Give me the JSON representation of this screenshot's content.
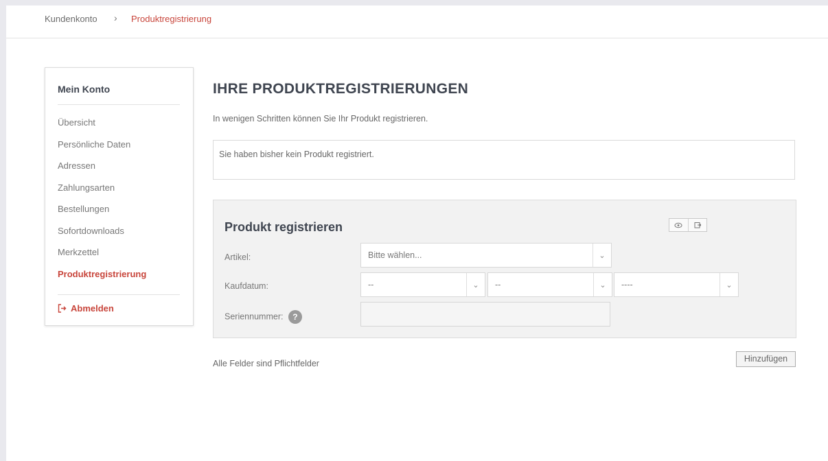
{
  "breadcrumb": {
    "home": "Kundenkonto",
    "separator": "›",
    "current": "Produktregistrierung"
  },
  "sidebar": {
    "title": "Mein Konto",
    "items": [
      {
        "label": "Übersicht"
      },
      {
        "label": "Persönliche Daten"
      },
      {
        "label": "Adressen"
      },
      {
        "label": "Zahlungsarten"
      },
      {
        "label": "Bestellungen"
      },
      {
        "label": "Sofortdownloads"
      },
      {
        "label": "Merkzettel"
      },
      {
        "label": "Produktregistrierung"
      }
    ],
    "logout_label": "Abmelden"
  },
  "main": {
    "title": "IHRE PRODUKTREGISTRIERUNGEN",
    "intro": "In wenigen Schritten können Sie Ihr Produkt registrieren.",
    "notice": "Sie haben bisher kein Produkt registriert."
  },
  "form": {
    "heading": "Produkt registrieren",
    "icons": [
      "view-icon",
      "export-icon"
    ],
    "article_label": "Artikel:",
    "article_value": "Bitte wählen...",
    "date_label": "Kaufdatum:",
    "day_value": "--",
    "month_value": "--",
    "year_value": "----",
    "serial_label": "Seriennummer:",
    "serial_value": ""
  },
  "footer": {
    "required_note": "Alle Felder sind Pflichtfelder",
    "add_button": "Hinzufügen"
  },
  "colors": {
    "accent": "#c8453b",
    "heading": "#3f4550"
  }
}
